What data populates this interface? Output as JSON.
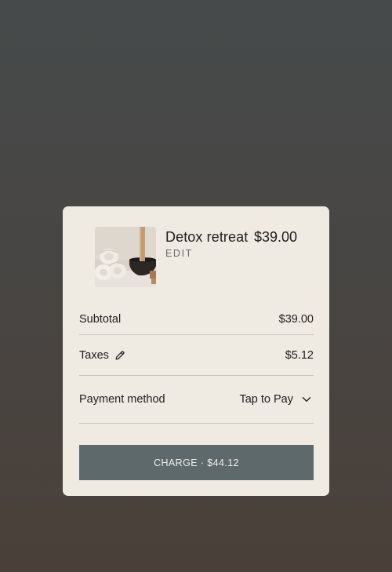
{
  "cart": {
    "item": {
      "name": "Detox retreat",
      "edit_label": "EDIT",
      "price": "$39.00",
      "image_icon": "spa-towels-image"
    },
    "subtotal": {
      "label": "Subtotal",
      "value": "$39.00"
    },
    "taxes": {
      "label": "Taxes",
      "value": "$5.12",
      "icon": "pencil-icon"
    },
    "payment": {
      "label": "Payment method",
      "value": "Tap to Pay",
      "icon": "chevron-down-icon"
    },
    "charge_label": "CHARGE · $44.12"
  },
  "colors": {
    "card_background": "#efeae2",
    "charge_button": "#5e696c",
    "page_background_top": "#464a4a",
    "page_background_bottom": "#4a4039"
  }
}
